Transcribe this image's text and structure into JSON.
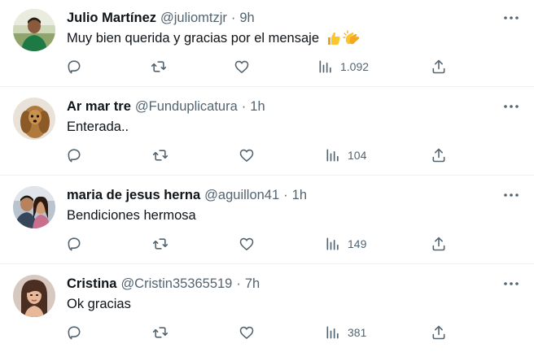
{
  "tweets": [
    {
      "name": "Julio Martínez",
      "handle": "@juliomtzjr",
      "dot": "·",
      "time": "9h",
      "text": "Muy bien querida y gracias por el mensaje",
      "emojis": [
        "thumbs-up",
        "clapping-hands"
      ],
      "views": "1.092"
    },
    {
      "name": "Ar mar tre",
      "handle": "@Funduplicatura",
      "dot": "·",
      "time": "1h",
      "text": "Enterada..",
      "views": "104"
    },
    {
      "name": "maria de jesus herna",
      "handle": "@aguillon41",
      "dot": "·",
      "time": "1h",
      "text": "Bendiciones hermosa",
      "views": "149"
    },
    {
      "name": "Cristina",
      "handle": "@Cristin35365519",
      "dot": "·",
      "time": "7h",
      "text": "Ok gracias",
      "views": "381"
    }
  ],
  "icons": {
    "reply": "reply-icon",
    "retweet": "retweet-icon",
    "like": "like-icon",
    "views": "views-icon",
    "share": "share-icon",
    "more": "more-icon"
  },
  "colors": {
    "text": "#0f1419",
    "secondary": "#536471",
    "divider": "#eff3f4"
  }
}
